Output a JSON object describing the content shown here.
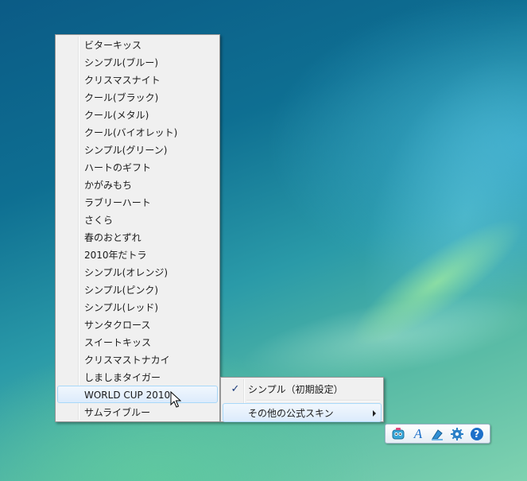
{
  "skin_menu": {
    "items": [
      "ビターキッス",
      "シンプル(ブルー)",
      "クリスマスナイト",
      "クール(ブラック)",
      "クール(メタル)",
      "クール(バイオレット)",
      "シンプル(グリーン)",
      "ハートのギフト",
      "かがみもち",
      "ラブリーハート",
      "さくら",
      "春のおとずれ",
      "2010年だトラ",
      "シンプル(オレンジ)",
      "シンプル(ピンク)",
      "シンプル(レッド)",
      "サンタクロース",
      "スイートキッス",
      "クリスマストナカイ",
      "しましまタイガー",
      "WORLD CUP 2010",
      "サムライブルー"
    ],
    "hovered_item": "WORLD CUP 2010"
  },
  "main_menu": {
    "simple_default_label": "シンプル（初期設定）",
    "simple_default_checked": true,
    "other_skins_label": "その他の公式スキン",
    "check_glyph": "✓"
  },
  "toolbar": {
    "buttons": [
      "robot-icon",
      "font-icon",
      "eraser-icon",
      "gear-icon",
      "help-icon"
    ],
    "help_glyph": "?",
    "font_glyph": "A"
  },
  "colors": {
    "menu_bg": "#f0f0f0",
    "hover_border": "#a8d8f9",
    "accent_blue": "#1d6fc9"
  }
}
